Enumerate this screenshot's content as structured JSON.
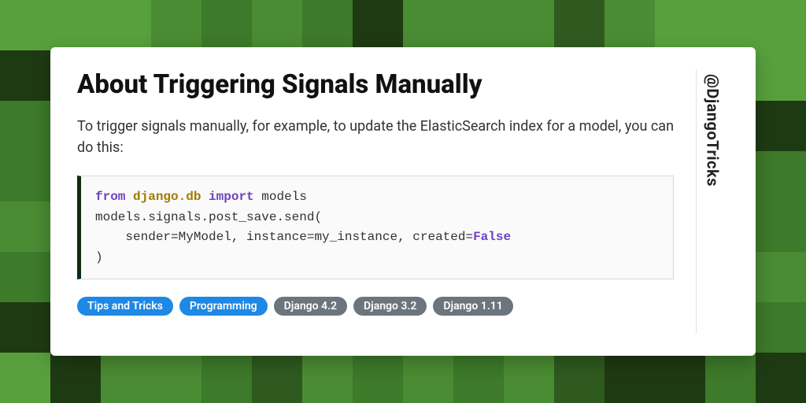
{
  "title": "About Triggering Signals Manually",
  "description": "To trigger signals manually, for example, to update the ElasticSearch index for a model, you can do this:",
  "handle": "@DjangoTricks",
  "code": {
    "kw_from": "from",
    "module": "django.db",
    "kw_import": "import",
    "import_name": "models",
    "line2": "models.signals.post_save.send(",
    "line3_indent": "    sender=MyModel, instance=my_instance, created=",
    "bool_false": "False",
    "line4": ")"
  },
  "tags": [
    {
      "label": "Tips and Tricks",
      "style": "blue"
    },
    {
      "label": "Programming",
      "style": "blue"
    },
    {
      "label": "Django 4.2",
      "style": "grey"
    },
    {
      "label": "Django 3.2",
      "style": "grey"
    },
    {
      "label": "Django 1.11",
      "style": "grey"
    }
  ]
}
